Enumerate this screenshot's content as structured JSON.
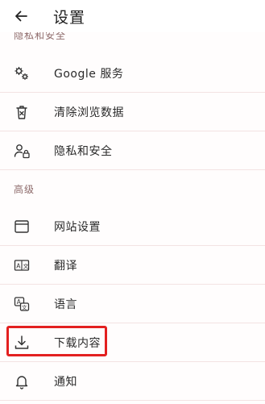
{
  "header": {
    "title": "设置",
    "back_icon": "arrow-left-icon"
  },
  "sections": {
    "privacy_partial_label": "隐私和安全",
    "advanced_label": "高级"
  },
  "items": {
    "google_services": {
      "label": "Google 服务",
      "icon": "google-services-icon"
    },
    "clear_browsing_data": {
      "label": "清除浏览数据",
      "icon": "trash-icon"
    },
    "privacy_security": {
      "label": "隐私和安全",
      "icon": "person-lock-icon"
    },
    "site_settings": {
      "label": "网站设置",
      "icon": "browser-window-icon"
    },
    "translate": {
      "label": "翻译",
      "icon": "translate-icon"
    },
    "languages": {
      "label": "语言",
      "icon": "language-icon"
    },
    "downloads": {
      "label": "下载内容",
      "icon": "download-icon"
    },
    "notifications": {
      "label": "通知",
      "icon": "bell-icon"
    }
  },
  "colors": {
    "highlight": "#e32020",
    "section_text": "#8e6b6b",
    "divider": "#f3e3e3"
  }
}
